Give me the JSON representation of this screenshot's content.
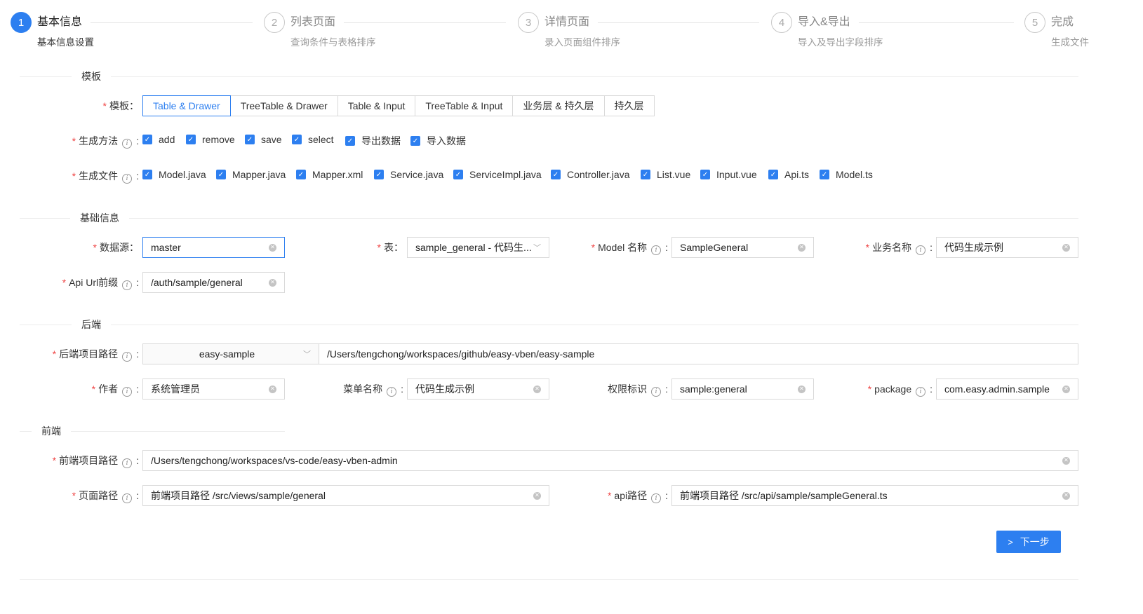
{
  "steps": [
    {
      "num": "1",
      "title": "基本信息",
      "desc": "基本信息设置",
      "active": true
    },
    {
      "num": "2",
      "title": "列表页面",
      "desc": "查询条件与表格排序",
      "active": false
    },
    {
      "num": "3",
      "title": "详情页面",
      "desc": "录入页面组件排序",
      "active": false
    },
    {
      "num": "4",
      "title": "导入&导出",
      "desc": "导入及导出字段排序",
      "active": false
    },
    {
      "num": "5",
      "title": "完成",
      "desc": "生成文件",
      "active": false
    }
  ],
  "sections": {
    "template": "模板",
    "basic": "基础信息",
    "backend": "后端",
    "frontend": "前端"
  },
  "labels": {
    "template": "模板",
    "methods": "生成方法",
    "files": "生成文件",
    "datasource": "数据源",
    "table": "表",
    "model_name": "Model 名称",
    "biz_name": "业务名称",
    "api_prefix": "Api Url前缀",
    "backend_path": "后端项目路径",
    "author": "作者",
    "menu_name": "菜单名称",
    "permission": "权限标识",
    "package": "package",
    "frontend_path": "前端项目路径",
    "page_path": "页面路径",
    "api_path": "api路径"
  },
  "template_options": [
    "Table & Drawer",
    "TreeTable & Drawer",
    "Table & Input",
    "TreeTable & Input",
    "业务层 & 持久层",
    "持久层"
  ],
  "methods": [
    "add",
    "remove",
    "save",
    "select",
    "导出数据",
    "导入数据"
  ],
  "files": [
    "Model.java",
    "Mapper.java",
    "Mapper.xml",
    "Service.java",
    "ServiceImpl.java",
    "Controller.java",
    "List.vue",
    "Input.vue",
    "Api.ts",
    "Model.ts"
  ],
  "values": {
    "datasource": "master",
    "table": "sample_general - 代码生...",
    "model_name": "SampleGeneral",
    "biz_name": "代码生成示例",
    "api_prefix": "/auth/sample/general",
    "backend_project": "easy-sample",
    "backend_path": "/Users/tengchong/workspaces/github/easy-vben/easy-sample",
    "author": "系统管理员",
    "menu_name": "代码生成示例",
    "permission": "sample:general",
    "package": "com.easy.admin.sample",
    "frontend_path": "/Users/tengchong/workspaces/vs-code/easy-vben-admin",
    "page_path": "前端项目路径 /src/views/sample/general",
    "api_path": "前端项目路径 /src/api/sample/sampleGeneral.ts"
  },
  "next_button": "下一步",
  "colors": {
    "primary": "#2d7ff0",
    "required": "#ef4444"
  }
}
